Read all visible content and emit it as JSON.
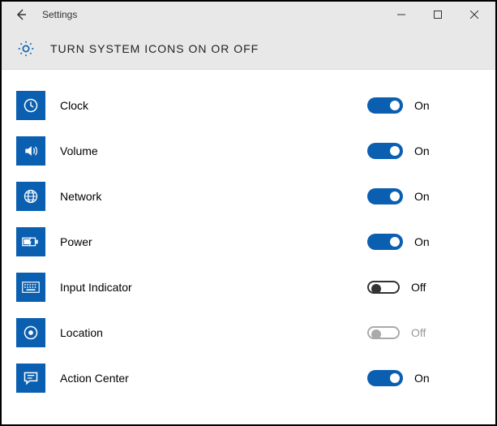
{
  "window": {
    "title": "Settings"
  },
  "page": {
    "heading": "TURN SYSTEM ICONS ON OR OFF"
  },
  "labels": {
    "on": "On",
    "off": "Off"
  },
  "colors": {
    "accent": "#0a5fb1"
  },
  "items": [
    {
      "id": "clock",
      "label": "Clock",
      "icon": "clock-icon",
      "state": "on",
      "enabled": true
    },
    {
      "id": "volume",
      "label": "Volume",
      "icon": "volume-icon",
      "state": "on",
      "enabled": true
    },
    {
      "id": "network",
      "label": "Network",
      "icon": "network-icon",
      "state": "on",
      "enabled": true
    },
    {
      "id": "power",
      "label": "Power",
      "icon": "power-icon",
      "state": "on",
      "enabled": true
    },
    {
      "id": "input-indicator",
      "label": "Input Indicator",
      "icon": "keyboard-icon",
      "state": "off",
      "enabled": true
    },
    {
      "id": "location",
      "label": "Location",
      "icon": "location-icon",
      "state": "off",
      "enabled": false
    },
    {
      "id": "action-center",
      "label": "Action Center",
      "icon": "message-icon",
      "state": "on",
      "enabled": true
    }
  ]
}
